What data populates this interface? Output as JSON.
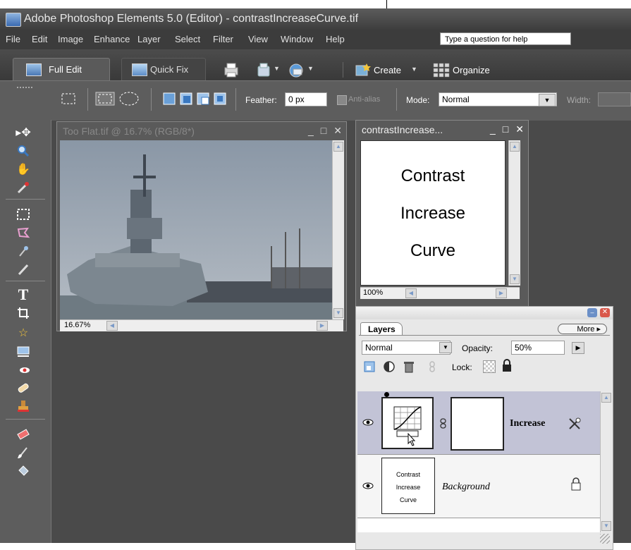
{
  "window": {
    "title": "Adobe Photoshop Elements 5.0 (Editor) - contrastIncreaseCurve.tif"
  },
  "menu": {
    "items": [
      "File",
      "Edit",
      "Image",
      "Enhance",
      "Layer",
      "Select",
      "Filter",
      "View",
      "Window",
      "Help"
    ],
    "help_placeholder": "Type a question for help"
  },
  "tabs": {
    "full_edit": "Full Edit",
    "quick_fix": "Quick Fix",
    "create": "Create",
    "organize": "Organize"
  },
  "options": {
    "feather_label": "Feather:",
    "feather_value": "0 px",
    "antialias_label": "Anti-alias",
    "mode_label": "Mode:",
    "mode_value": "Normal",
    "width_label": "Width:"
  },
  "doc1": {
    "title": "Too Flat.tif @ 16.7% (RGB/8*)",
    "zoom": "16.67%"
  },
  "doc2": {
    "title": "contrastIncrease...",
    "text_lines": [
      "Contrast",
      "Increase",
      "Curve"
    ],
    "zoom": "100%"
  },
  "layers": {
    "tab_label": "Layers",
    "more_label": "More",
    "blend_mode": "Normal",
    "opacity_label": "Opacity:",
    "opacity_value": "50%",
    "lock_label": "Lock:",
    "rows": [
      {
        "name": "Increase",
        "type": "adjustment"
      },
      {
        "name": "Background",
        "thumb_lines": [
          "Contrast",
          "Increase",
          "Curve"
        ]
      }
    ]
  }
}
